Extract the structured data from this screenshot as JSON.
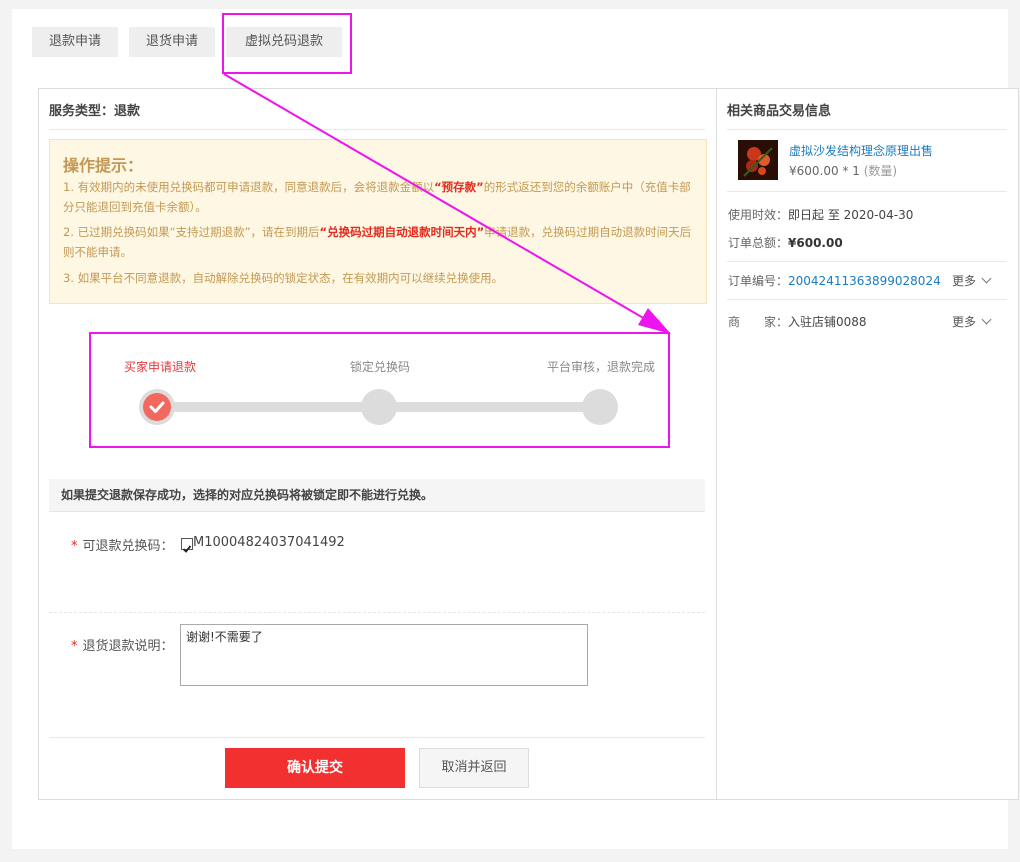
{
  "tabs": [
    "退款申请",
    "退货申请",
    "虚拟兑码退款"
  ],
  "main": {
    "service_type": "服务类型：退款",
    "tips": {
      "title": "操作提示：",
      "line1_a": "1. 有效期内的未使用兑换码都可申请退款，同意退款后，会将退款金额以",
      "line1_b": "“预存款”",
      "line1_c": "的形式返还到您的余额账户中（充值卡部分只能退回到充值卡余额）。",
      "line2_a": "2. 已过期兑换码如果“支持过期退款”，请在到期后",
      "line2_b": "“兑换码过期自动退款时间天内”",
      "line2_c": "申请退款，兑换码过期自动退款时间天后则不能申请。",
      "line3": "3. 如果平台不同意退款，自动解除兑换码的锁定状态，在有效期内可以继续兑换使用。"
    },
    "steps": [
      "买家申请退款",
      "锁定兑换码",
      "平台审核，退款完成"
    ],
    "notice": "如果提交退款保存成功，选择的对应兑换码将被锁定即不能进行兑换。",
    "code_label": "可退款兑换码：",
    "code_value": "M10004824037041492",
    "reason_label": "退货退款说明：",
    "reason_text": "谢谢!不需要了",
    "submit": "确认提交",
    "cancel": "取消并返回"
  },
  "side": {
    "title": "相关商品交易信息",
    "product_name": "虚拟沙发结构理念原理出售",
    "product_price": "¥600.00 * 1",
    "product_qty": "(数量)",
    "validity_label": "使用时效：",
    "validity_value": "即日起 至 2020-04-30",
    "total_label": "订单总额：",
    "total_value": "¥600.00",
    "order_label": "订单编号：",
    "order_value": "20042411363899028024",
    "shop_label": "商　　家：",
    "shop_value": "入驻店铺0088",
    "more": "更多"
  },
  "colors": {
    "accent_red": "#f23030",
    "highlight_magenta": "#ee14ee",
    "tip_text": "#c29954"
  }
}
